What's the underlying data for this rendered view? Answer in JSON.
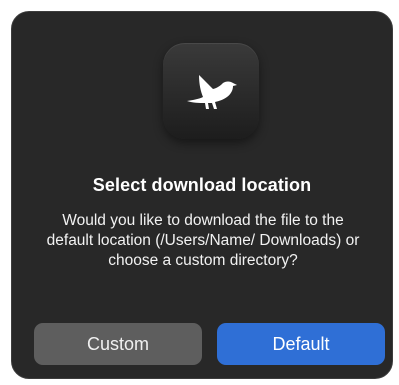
{
  "dialog": {
    "title": "Select download location",
    "message": "Would you like to download the file to the default location (/Users/Name/ Downloads) or choose a custom directory?",
    "app_icon": "raven-bird-icon",
    "buttons": {
      "custom_label": "Custom",
      "default_label": "Default"
    }
  },
  "colors": {
    "dialog_background": "#282828",
    "default_button": "#2f6fd6",
    "secondary_button": "#5e5e5e"
  }
}
